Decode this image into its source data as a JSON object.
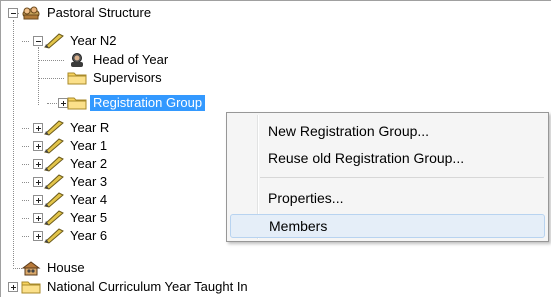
{
  "tree": {
    "root": {
      "label": "Pastoral Structure",
      "icon": "pastoral-structure-icon"
    },
    "year_n2": {
      "label": "Year  N2",
      "children": [
        {
          "label": "Head of Year",
          "icon": "head-of-year-icon"
        },
        {
          "label": "Supervisors",
          "icon": "folder-icon"
        },
        {
          "label": "Registration Group",
          "icon": "folder-icon",
          "selected": true
        }
      ]
    },
    "years": [
      {
        "label": "Year  R"
      },
      {
        "label": "Year  1"
      },
      {
        "label": "Year  2"
      },
      {
        "label": "Year  3"
      },
      {
        "label": "Year  4"
      },
      {
        "label": "Year  5"
      },
      {
        "label": "Year  6"
      }
    ],
    "house": {
      "label": "House",
      "icon": "house-icon"
    },
    "national_curriculum": {
      "label": "National Curriculum Year Taught In",
      "icon": "folder-icon"
    }
  },
  "context_menu": {
    "items": [
      {
        "label": "New Registration Group..."
      },
      {
        "label": "Reuse old Registration Group..."
      },
      {
        "label": "Properties..."
      },
      {
        "label": "Members",
        "hovered": true
      }
    ]
  },
  "colors": {
    "selection": "#3399ff",
    "menu_bg": "#f5f5f5",
    "menu_hover": "#e5eef8",
    "folder": "#f7d35e",
    "pencil": "#e2c44a"
  }
}
